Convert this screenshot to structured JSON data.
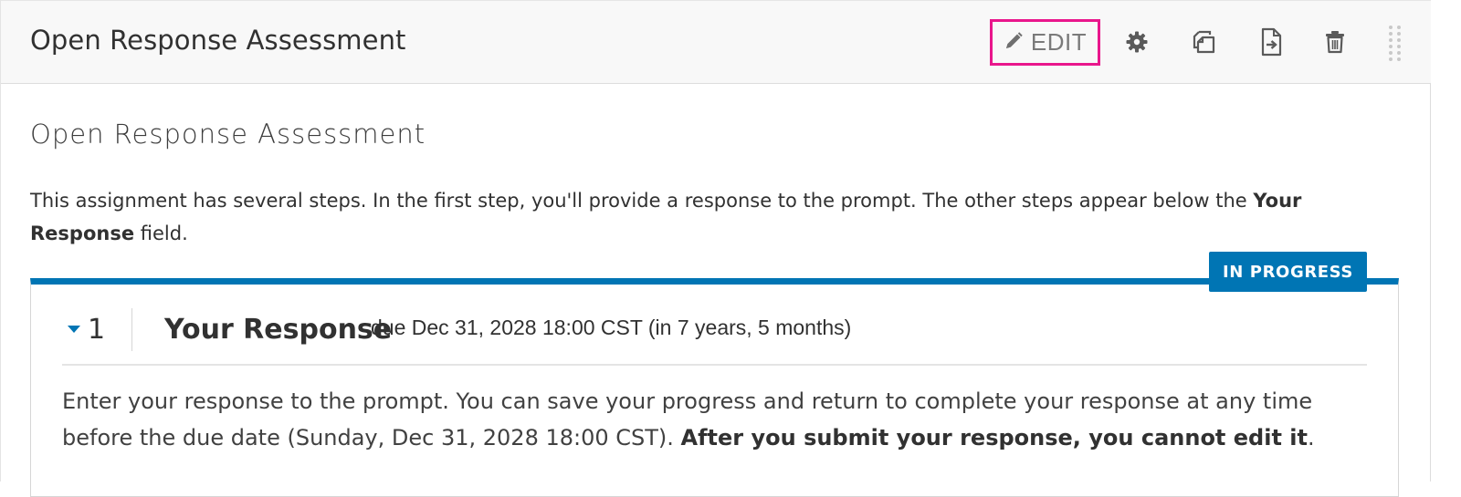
{
  "header": {
    "title": "Open Response Assessment",
    "edit_label": "EDIT",
    "actions": [
      {
        "icon": "gear-icon",
        "label": ""
      },
      {
        "icon": "duplicate-icon",
        "label": ""
      },
      {
        "icon": "move-icon",
        "label": ""
      },
      {
        "icon": "trash-icon",
        "label": ""
      }
    ]
  },
  "assessment": {
    "title": "Open Response Assessment",
    "intro_part1": "This assignment has several steps. In the first step, you'll provide a response to the prompt. The other steps appear below the ",
    "intro_bold": "Your Response",
    "intro_part2": " field."
  },
  "status": {
    "badge": "IN PROGRESS"
  },
  "step": {
    "number": "1",
    "title": "Your Response",
    "due": "due Dec 31, 2028 18:00 CST (in 7 years, 5 months)",
    "instructions_part1": "Enter your response to the prompt. You can save your progress and return to complete your response at any time before the due date (Sunday, Dec 31, 2028 18:00 CST). ",
    "instructions_bold": "After you submit your response, you cannot edit it",
    "instructions_part2": "."
  },
  "colors": {
    "accent_blue": "#0075b4",
    "highlight_pink": "#e9168c"
  }
}
